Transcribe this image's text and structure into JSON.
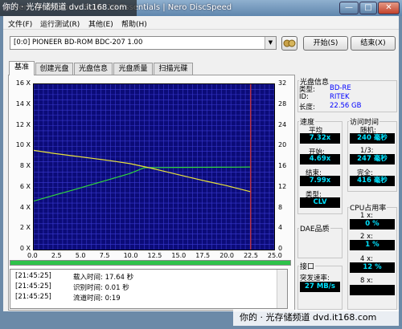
{
  "titlebar": {
    "title": "Nero Mediahome Suite 10 Essentials | Nero DiscSpeed",
    "minimize": "—",
    "maximize": "□",
    "close": "✕"
  },
  "watermark": {
    "top": "你的 · 光存储频道  dvd.it168.com",
    "bottom": "你的 · 光存储频道  dvd.it168.com"
  },
  "menu": [
    "文件(F)",
    "运行测试(R)",
    "其他(E)",
    "帮助(H)"
  ],
  "drive": {
    "selected": "[0:0]  PIONEER BD-ROM  BDC-207 1.00"
  },
  "buttons": {
    "start": "开始(S)",
    "exit": "结束(X)"
  },
  "tabs": [
    {
      "label": "基准",
      "active": true
    },
    {
      "label": "创建光盘"
    },
    {
      "label": "光盘信息"
    },
    {
      "label": "光盘质量"
    },
    {
      "label": "扫描光碟"
    }
  ],
  "disc_info": {
    "title": "光盘信息",
    "type_label": "类型:",
    "type_value": "BD-RE",
    "id_label": "ID:",
    "id_value": "RITEK",
    "length_label": "长度:",
    "length_value": "22.56 GB"
  },
  "speed": {
    "title": "速度",
    "avg_label": "平均",
    "avg_value": "7.32x",
    "start_label": "开始:",
    "start_value": "4.69x",
    "end_label": "结束:",
    "end_value": "7.99x",
    "type_label": "类型:",
    "type_value": "CLV"
  },
  "access": {
    "title": "访问时间",
    "random_label": "随机:",
    "random_value": "240 毫秒",
    "third_label": "1/3:",
    "third_value": "247 毫秒",
    "full_label": "完全:",
    "full_value": "416 毫秒"
  },
  "cpu": {
    "title": "CPU占用率",
    "x1_label": "1 x:",
    "x1_value": "0 %",
    "x2_label": "2 x:",
    "x2_value": "1 %",
    "x4_label": "4 x:",
    "x4_value": "12 %",
    "x8_label": "8 x:",
    "x8_value": ""
  },
  "dae": {
    "title": "DAE品质"
  },
  "interface": {
    "title": "接口",
    "burst_label": "突发速率:",
    "burst_value": "27 MB/s"
  },
  "progress": {
    "value": 1.0
  },
  "log": [
    {
      "time": "[21:45:25]",
      "text": "载入时间: 17.64 秒"
    },
    {
      "time": "[21:45:25]",
      "text": "识别时间: 0.01 秒"
    },
    {
      "time": "[21:45:25]",
      "text": "流道时间:   0:19"
    }
  ],
  "colors": {
    "plot_bg": "#0b0b78",
    "grid": "#3b3bd0",
    "read_curve": "#2fd63a",
    "rpm_curve": "#e8e23a",
    "end_marker": "#d8342a",
    "value_text": "#00e3ff"
  },
  "chart_data": {
    "type": "line",
    "xlim": [
      0,
      25
    ],
    "ylim": [
      0,
      16
    ],
    "y2lim": [
      0,
      32
    ],
    "x_ticks": [
      "0.0",
      "2.5",
      "5.0",
      "7.5",
      "10.0",
      "12.5",
      "15.0",
      "17.5",
      "20.0",
      "22.5",
      "25.0"
    ],
    "y_ticks": [
      "0 X",
      "2 X",
      "4 X",
      "6 X",
      "8 X",
      "10 X",
      "12 X",
      "14 X",
      "16 X"
    ],
    "y2_ticks": [
      "0",
      "4",
      "8",
      "12",
      "16",
      "20",
      "24",
      "28",
      "32"
    ],
    "end_marker_x": 22.56,
    "series": [
      {
        "color": "#2fd63a",
        "x": [
          0,
          2,
          4,
          6,
          8,
          10,
          11.5,
          13,
          15,
          17,
          19,
          21,
          22.56
        ],
        "y": [
          4.69,
          5.23,
          5.74,
          6.28,
          6.82,
          7.36,
          7.92,
          7.94,
          7.95,
          7.96,
          7.97,
          7.98,
          7.99
        ]
      },
      {
        "color": "#e8e23a",
        "x": [
          0,
          2,
          4,
          6,
          8,
          10,
          12,
          14,
          16,
          18,
          20,
          22.56
        ],
        "y": [
          9.6,
          9.32,
          9.08,
          8.84,
          8.6,
          8.32,
          7.92,
          7.48,
          7.04,
          6.6,
          6.2,
          5.6
        ]
      }
    ]
  }
}
